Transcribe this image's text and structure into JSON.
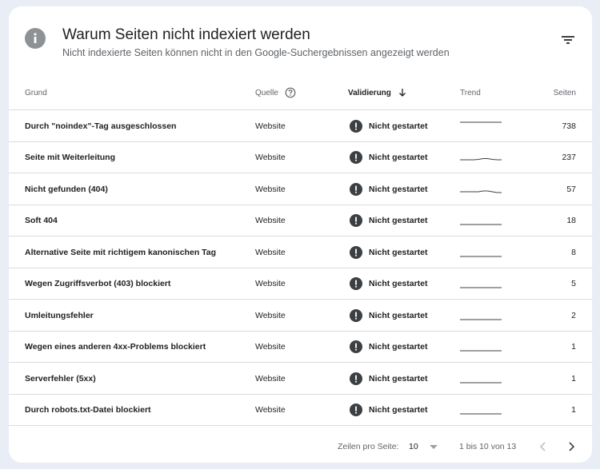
{
  "header": {
    "title": "Warum Seiten nicht indexiert werden",
    "subtitle": "Nicht indexierte Seiten können nicht in den Google-Suchergebnissen angezeigt werden",
    "icon": "info-icon",
    "filter_icon": "filter-icon"
  },
  "table": {
    "columns": {
      "grund": "Grund",
      "quelle": "Quelle",
      "validierung": "Validierung",
      "trend": "Trend",
      "seiten": "Seiten"
    },
    "rows": [
      {
        "grund": "Durch \"noindex\"-Tag ausgeschlossen",
        "quelle": "Website",
        "validierung": "Nicht gestartet",
        "seiten": "738",
        "trend": [
          1,
          1,
          1,
          1,
          1,
          1,
          1,
          1,
          1,
          1
        ]
      },
      {
        "grund": "Seite mit Weiterleitung",
        "quelle": "Website",
        "validierung": "Nicht gestartet",
        "seiten": "237",
        "trend": [
          0.2,
          0.2,
          0.2,
          0.2,
          0.25,
          0.35,
          0.35,
          0.25,
          0.2,
          0.2
        ]
      },
      {
        "grund": "Nicht gefunden (404)",
        "quelle": "Website",
        "validierung": "Nicht gestartet",
        "seiten": "57",
        "trend": [
          0.2,
          0.2,
          0.2,
          0.2,
          0.2,
          0.3,
          0.3,
          0.2,
          0.1,
          0.1
        ]
      },
      {
        "grund": "Soft 404",
        "quelle": "Website",
        "validierung": "Nicht gestartet",
        "seiten": "18",
        "trend": [
          0,
          0,
          0,
          0,
          0,
          0,
          0,
          0,
          0,
          0
        ]
      },
      {
        "grund": "Alternative Seite mit richtigem kanonischen Tag",
        "quelle": "Website",
        "validierung": "Nicht gestartet",
        "seiten": "8",
        "trend": [
          0,
          0,
          0,
          0,
          0,
          0,
          0,
          0,
          0,
          0
        ]
      },
      {
        "grund": "Wegen Zugriffsverbot (403) blockiert",
        "quelle": "Website",
        "validierung": "Nicht gestartet",
        "seiten": "5",
        "trend": [
          0,
          0,
          0,
          0,
          0,
          0,
          0,
          0,
          0,
          0
        ]
      },
      {
        "grund": "Umleitungsfehler",
        "quelle": "Website",
        "validierung": "Nicht gestartet",
        "seiten": "2",
        "trend": [
          0,
          0,
          0,
          0,
          0,
          0,
          0,
          0,
          0,
          0
        ]
      },
      {
        "grund": "Wegen eines anderen 4xx-Problems blockiert",
        "quelle": "Website",
        "validierung": "Nicht gestartet",
        "seiten": "1",
        "trend": [
          0,
          0,
          0,
          0,
          0,
          0,
          0,
          0,
          0,
          0
        ]
      },
      {
        "grund": "Serverfehler (5xx)",
        "quelle": "Website",
        "validierung": "Nicht gestartet",
        "seiten": "1",
        "trend": [
          0,
          0,
          0,
          0,
          0,
          0,
          0,
          0,
          0,
          0
        ]
      },
      {
        "grund": "Durch robots.txt-Datei blockiert",
        "quelle": "Website",
        "validierung": "Nicht gestartet",
        "seiten": "1",
        "trend": [
          0,
          0,
          0,
          0,
          0,
          0,
          0,
          0,
          0,
          0
        ]
      }
    ]
  },
  "footer": {
    "rows_per_page_label": "Zeilen pro Seite:",
    "rows_per_page_value": "10",
    "range": "1 bis 10 von 13"
  },
  "colors": {
    "accent": "#202124",
    "status_icon": "#3c4043",
    "divider": "#dadce0",
    "background": "#e9eef6"
  }
}
